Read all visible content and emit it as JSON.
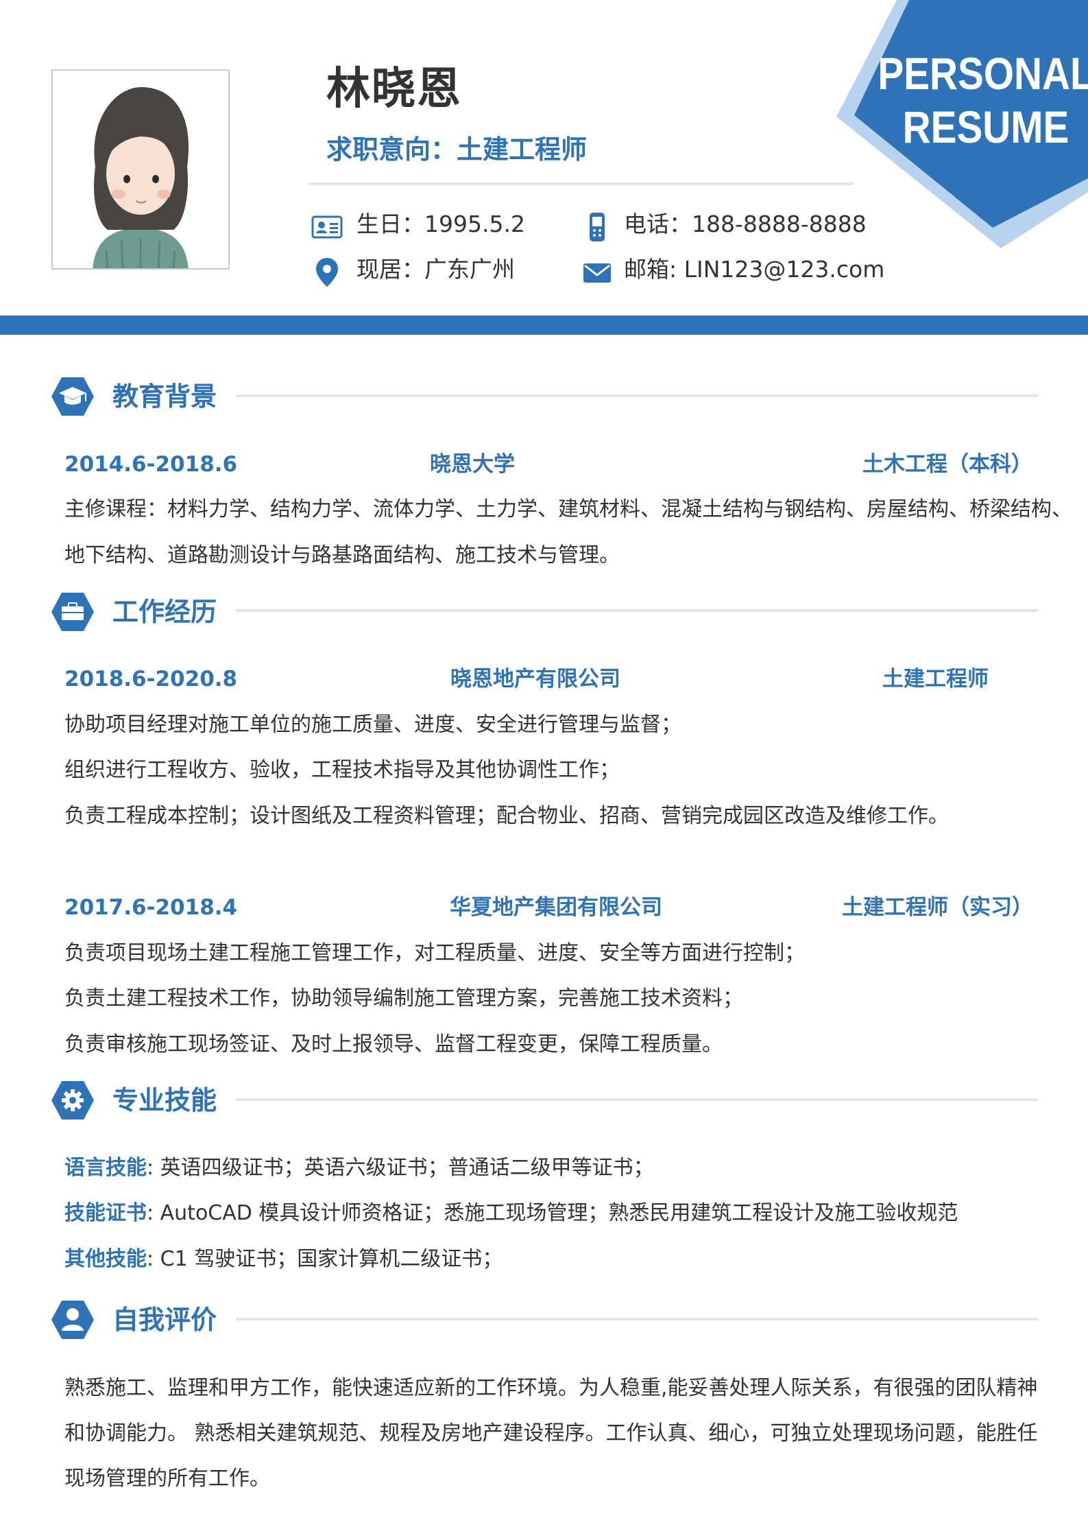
{
  "header": {
    "name": "林晓恩",
    "objective": "求职意向：土建工程师",
    "birthday": "生日：1995.5.2",
    "phone": "电话：188-8888-8888",
    "residence": "现居：广东广州",
    "email": "邮箱: LIN123@123.com",
    "badge_line1": "PERSONAL",
    "badge_line2": "RESUME"
  },
  "colors": {
    "accent": "#2e73b8",
    "accent_light": "#b8d3ef",
    "divider": "#e6e6e6",
    "text": "#333333"
  },
  "education": {
    "title": "教育背景",
    "icon": "graduation-cap-icon",
    "entries": [
      {
        "date": "2014.6-2018.6",
        "school": "晓恩大学",
        "major": "土木工程（本科）",
        "lines": [
          "主修课程：材料力学、结构力学、流体力学、土力学、建筑材料、混凝土结构与钢结构、房屋结构、桥梁结构、",
          "地下结构、道路勘测设计与路基路面结构、施工技术与管理。"
        ]
      }
    ]
  },
  "work": {
    "title": "工作经历",
    "icon": "briefcase-icon",
    "entries": [
      {
        "date": "2018.6-2020.8",
        "company": "晓恩地产有限公司",
        "role": "土建工程师",
        "lines": [
          "协助项目经理对施工单位的施工质量、进度、安全进行管理与监督；",
          "组织进行工程收方、验收，工程技术指导及其他协调性工作；",
          "负责工程成本控制；设计图纸及工程资料管理；配合物业、招商、营销完成园区改造及维修工作。"
        ]
      },
      {
        "date": "2017.6-2018.4",
        "company": "华夏地产集团有限公司",
        "role": "土建工程师（实习）",
        "lines": [
          "负责项目现场土建工程施工管理工作，对工程质量、进度、安全等方面进行控制；",
          "负责土建工程技术工作，协助领导编制施工管理方案，完善施工技术资料；",
          "负责审核施工现场签证、及时上报领导、监督工程变更，保障工程质量。"
        ]
      }
    ]
  },
  "skills": {
    "title": "专业技能",
    "icon": "gear-icon",
    "items": [
      {
        "label": "语言技能",
        "sep": ":",
        "text": "  英语四级证书；英语六级证书；普通话二级甲等证书；"
      },
      {
        "label": "技能证书",
        "sep": ":",
        "text": " AutoCAD 模具设计师资格证；悉施工现场管理；熟悉民用建筑工程设计及施工验收规范"
      },
      {
        "label": "其他技能",
        "sep": ":",
        "text": " C1 驾驶证书；国家计算机二级证书；"
      }
    ]
  },
  "evaluation": {
    "title": "自我评价",
    "icon": "user-icon",
    "lines": [
      "熟悉施工、监理和甲方工作，能快速适应新的工作环境。为人稳重,能妥善处理人际关系，有很强的团队精神",
      "和协调能力。 熟悉相关建筑规范、规程及房地产建设程序。工作认真、细心，可独立处理现场问题，能胜任",
      "现场管理的所有工作。"
    ]
  }
}
